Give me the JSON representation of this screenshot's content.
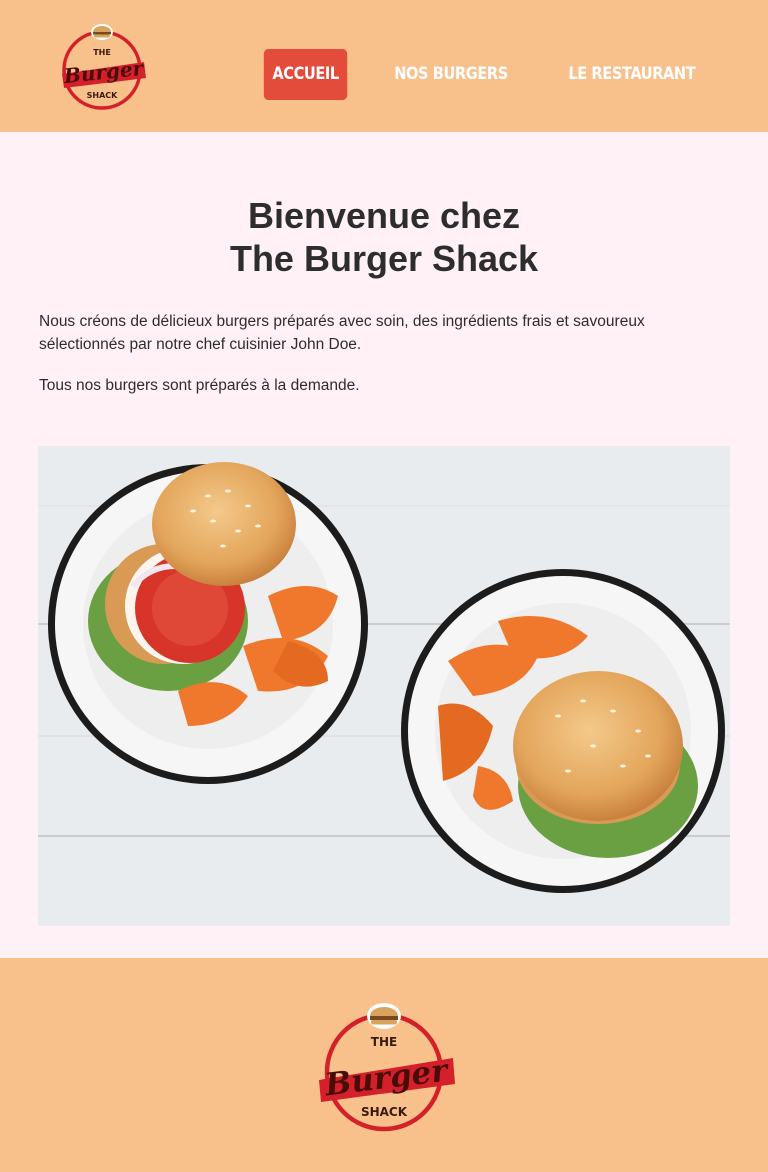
{
  "logo": {
    "the": "THE",
    "burger": "Burger",
    "shack": "SHACK"
  },
  "nav": {
    "items": [
      {
        "label": "ACCUEIL",
        "active": true
      },
      {
        "label": "NOS BURGERS",
        "active": false
      },
      {
        "label": "LE RESTAURANT",
        "active": false
      }
    ]
  },
  "main": {
    "title_line1": "Bienvenue chez",
    "title_line2": "The Burger Shack",
    "paragraph1": "Nous créons de délicieux burgers préparés avec soin, des ingrédients frais et savoureux sélectionnés par notre chef cuisinier John Doe.",
    "paragraph2": "Tous nos burgers sont préparés à la demande."
  },
  "colors": {
    "header_bg": "#f8c18c",
    "page_bg": "#fff1f5",
    "nav_active": "#e34b3b",
    "logo_red": "#d4202a",
    "logo_dark": "#7a1510"
  }
}
